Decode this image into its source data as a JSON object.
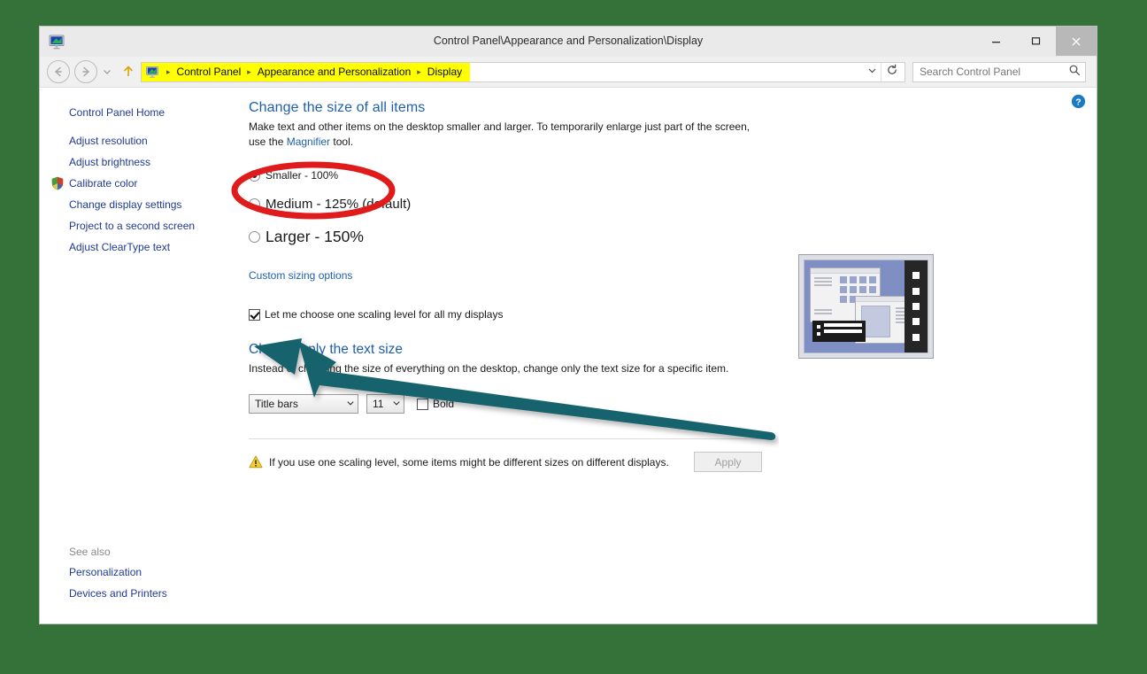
{
  "desktop": {
    "background": "#35723a"
  },
  "window": {
    "title": "Control Panel\\Appearance and Personalization\\Display",
    "icon": "display-monitor-icon",
    "minimize_label": "–",
    "maximize_label": "□",
    "close_label": "×"
  },
  "toolbar": {
    "back_label": "←",
    "forward_label": "→",
    "history_label": "▾",
    "up_label": "↑",
    "refresh_label": "↻",
    "address_dropdown_label": "⌄",
    "breadcrumbs": [
      "Control Panel",
      "Appearance and Personalization",
      "Display"
    ],
    "breadcrumb_separator": "▸",
    "breadcrumb_highlight_color": "#ffff00",
    "search": {
      "placeholder": "Search Control Panel",
      "value": "",
      "icon": "search-icon"
    }
  },
  "help": {
    "label": "?",
    "color": "#1a7ac4"
  },
  "sidebar": {
    "home_label": "Control Panel Home",
    "items": [
      {
        "label": "Adjust resolution",
        "shield": false
      },
      {
        "label": "Adjust brightness",
        "shield": false
      },
      {
        "label": "Calibrate color",
        "shield": true
      },
      {
        "label": "Change display settings",
        "shield": false
      },
      {
        "label": "Project to a second screen",
        "shield": false
      },
      {
        "label": "Adjust ClearType text",
        "shield": false
      }
    ],
    "see_also_title": "See also",
    "see_also": [
      "Personalization",
      "Devices and Printers"
    ]
  },
  "main": {
    "heading": "Change the size of all items",
    "description_part1": "Make text and other items on the desktop smaller and larger. To temporarily enlarge just part of the screen, use the ",
    "description_link": "Magnifier",
    "description_part2": " tool.",
    "scale_options": [
      {
        "label": "Smaller - 100%",
        "selected": true
      },
      {
        "label": "Medium - 125% (default)",
        "selected": false
      },
      {
        "label": "Larger - 150%",
        "selected": false
      }
    ],
    "custom_sizing_link": "Custom sizing options",
    "one_scaling_checkbox": {
      "label": "Let me choose one scaling level for all my displays",
      "checked": true
    },
    "text_size_heading": "Change only the text size",
    "text_size_description": "Instead of changing the size of everything on the desktop, change only the text size for a specific item.",
    "item_select": {
      "value": "Title bars"
    },
    "size_select": {
      "value": "11"
    },
    "bold_checkbox": {
      "label": "Bold",
      "checked": false
    },
    "warning_text": "If you use one scaling level, some items might be different sizes on different displays.",
    "warning_icon": "warning-triangle-icon",
    "apply_button": {
      "label": "Apply",
      "enabled": false
    },
    "preview_icon": "display-preview-thumbnail"
  },
  "annotations": {
    "ellipse": {
      "color": "#e01b1b",
      "target": "Smaller - 100%"
    },
    "arrow": {
      "color": "#17646e",
      "target": "Let me choose one scaling level for all my displays"
    }
  }
}
